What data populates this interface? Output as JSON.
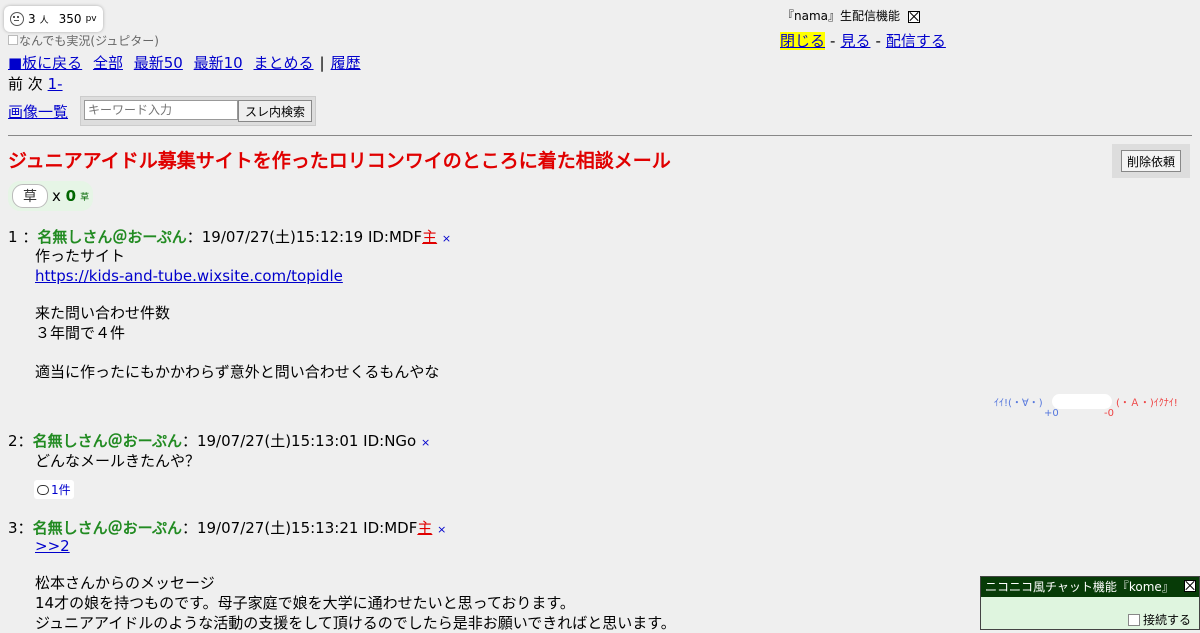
{
  "counter": {
    "people": "3",
    "people_unit": "人",
    "pv": "350",
    "pv_unit": "pv"
  },
  "board_name": "なんでも実況(ジュピター)",
  "nav": {
    "back": "■板に戻る",
    "all": "全部",
    "latest50": "最新50",
    "latest10": "最新10",
    "matome": "まとめる",
    "sep": "|",
    "history": "履歴"
  },
  "pager": {
    "prev": "前",
    "next": "次",
    "range": "1-"
  },
  "images_link": "画像一覧",
  "search": {
    "placeholder": "キーワード入力",
    "button": "スレ内検索"
  },
  "thread_title": "ジュニアアイドル募集サイトを作ったロリコンワイのところに着た相談メール",
  "delete_button": "削除依頼",
  "kusa": {
    "button": "草",
    "x": "x",
    "count": "0",
    "unit": "草"
  },
  "nama": {
    "label": "『nama』生配信機能",
    "close": "閉じる",
    "view": "見る",
    "stream": "配信する",
    "sep": "-"
  },
  "posts": [
    {
      "num": "1",
      "sep": "：",
      "name": "名無しさん＠おーぷん",
      "datetime": "：19/07/27(土)15:12:19 ID:MDF",
      "nushi": "主",
      "x": "×",
      "lines": [
        "作ったサイト"
      ],
      "link": "https://kids-and-tube.wixsite.com/topidle",
      "lines2": [
        "来た問い合わせ件数",
        "３年間で４件"
      ],
      "lines3": [
        "適当に作ったにもかかわらず意外と問い合わせくるもんやな"
      ]
    },
    {
      "num": "2",
      "sep": "：",
      "name": "名無しさん＠おーぷん",
      "datetime": "：19/07/27(土)15:13:01 ID:NGo",
      "x": "×",
      "lines": [
        "どんなメールきたんや？"
      ],
      "reply_count": "1件"
    },
    {
      "num": "3",
      "sep": "：",
      "name": "名無しさん＠おーぷん",
      "datetime": "：19/07/27(土)15:13:21 ID:MDF",
      "nushi": "主",
      "x": "×",
      "anchor": ">>2",
      "lines": [
        "松本さんからのメッセージ",
        "14才の娘を持つものです。母子家庭で娘を大学に通わせたいと思っております。",
        "ジュニアアイドルのような活動の支援をして頂けるのでしたら是非お願いできればと思います。"
      ]
    }
  ],
  "vote": {
    "good": "ｲｲ!(・∀・)",
    "bad": "(・Ａ・)ｲｸﾅｲ!",
    "good_count": "+0",
    "bad_count": "-0"
  },
  "chat": {
    "title": "ニコニコ風チャット機能『kome』",
    "connect": "接続する"
  }
}
